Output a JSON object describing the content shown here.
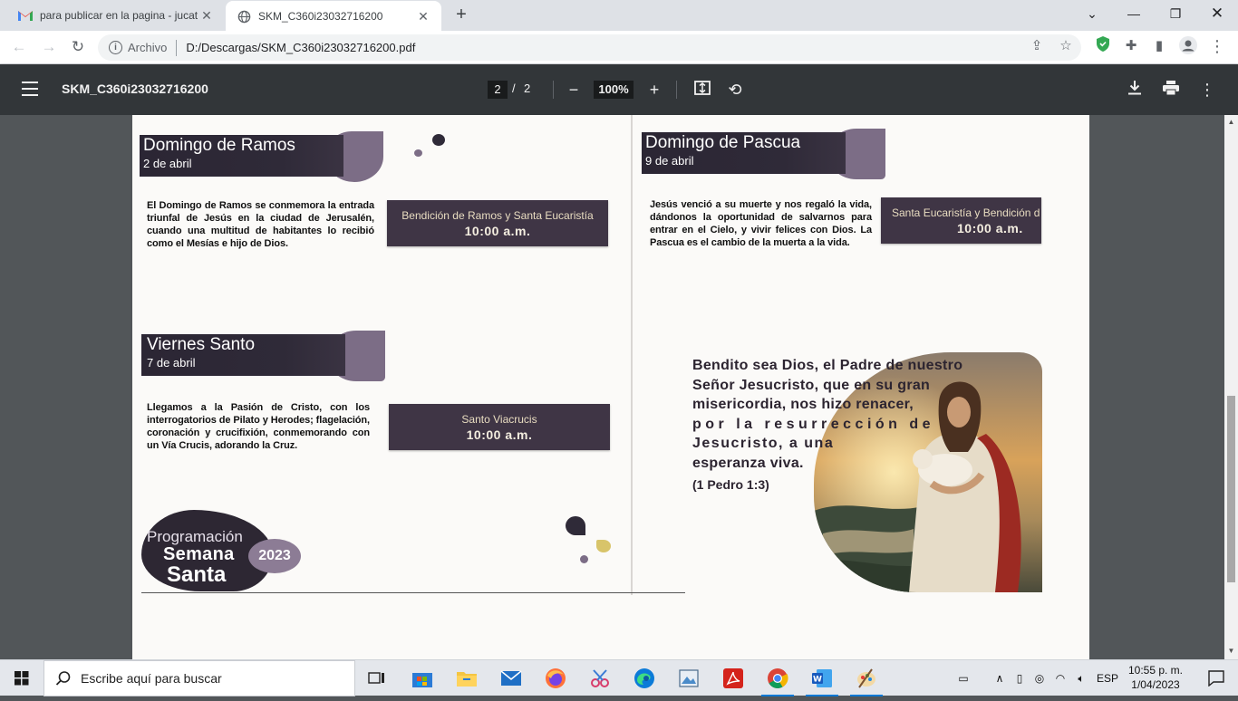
{
  "browser": {
    "tabs": [
      {
        "title": "para publicar en la pagina - jucat",
        "icon": "gmail-icon",
        "active": false
      },
      {
        "title": "SKM_C360i23032716200",
        "icon": "globe-icon",
        "active": true
      }
    ],
    "address": {
      "scheme_label": "Archivo",
      "url": "D:/Descargas/SKM_C360i23032716200.pdf"
    }
  },
  "pdf_viewer": {
    "document_title": "SKM_C360i23032716200",
    "current_page": "2",
    "page_separator": "/",
    "total_pages": "2",
    "zoom": "100%"
  },
  "page": {
    "sections": [
      {
        "title": "Domingo de Ramos",
        "date": "2 de abril",
        "text": "El Domingo de Ramos se conmemora la entrada triunfal de Jesús en la ciudad de Jerusalén, cuando una multitud de habitantes lo recibió como el Mesías e hijo de Dios.",
        "service": "Bendición de Ramos y Santa Eucaristía",
        "time": "10:00 a.m."
      },
      {
        "title": "Viernes Santo",
        "date": "7 de abril",
        "text": "Llegamos a la Pasión de Cristo, con los interrogatorios de Pilato y Herodes; flagelación, coronación y crucifixión, conmemorando con un Vía Crucis, adorando la Cruz.",
        "service": "Santo Viacrucis",
        "time": "10:00 a.m."
      },
      {
        "title": "Domingo de Pascua",
        "date": "9 de abril",
        "text": "Jesús venció a su muerte y nos regaló la vida, dándonos la oportunidad de salvarnos para entrar en el Cielo, y vivir felices con Dios. La Pascua es el cambio de la muerta a la vida.",
        "service": "Santa Eucaristía y Bendición d",
        "time": "10:00 a.m."
      }
    ],
    "badge": {
      "line1": "Programación",
      "line2": "Semana",
      "line3": "Santa",
      "year": "2023"
    },
    "quote": {
      "lines": [
        "Bendito sea Dios, el Padre de nuestro",
        "Señor Jesucristo, que en su gran",
        "misericordia, nos hizo renacer,",
        "por la resurrección de",
        "Jesucristo, a una",
        "esperanza viva."
      ],
      "citation": "(1 Pedro 1:3)"
    }
  },
  "taskbar": {
    "search_placeholder": "Escribe aquí para buscar",
    "language": "ESP",
    "time": "10:55 p. m.",
    "date": "1/04/2023"
  },
  "colors": {
    "header_bg": "#2b2634",
    "service_bg": "#3f3545",
    "blob": "#7c6d86",
    "pdf_toolbar": "#323639"
  }
}
